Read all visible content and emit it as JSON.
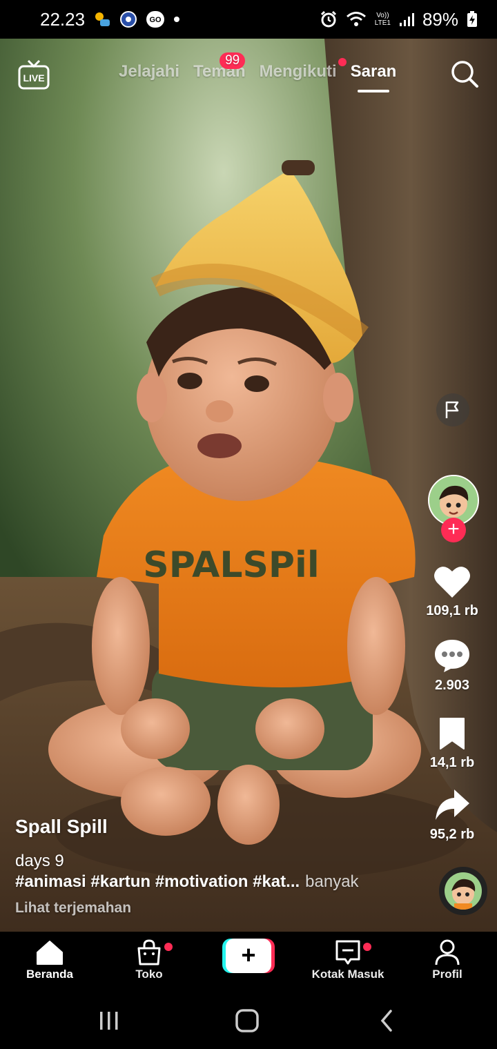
{
  "status_bar": {
    "time": "22.23",
    "network_top": "Vo))",
    "network_bottom": "LTE1",
    "battery": "89%"
  },
  "top_nav": {
    "live_label": "LIVE",
    "tabs": [
      {
        "label": "Jelajahi"
      },
      {
        "label": "Teman",
        "badge": "99"
      },
      {
        "label": "Mengikuti"
      },
      {
        "label": "Saran"
      }
    ]
  },
  "video": {
    "shirt_text": "SPALSPil"
  },
  "actions": {
    "likes": "109,1 rb",
    "comments": "2.903",
    "saves": "14,1 rb",
    "shares": "95,2 rb",
    "follow_symbol": "+"
  },
  "caption": {
    "author": "Spall Spill",
    "description": "days 9",
    "hashtags": "#animasi #kartun #motivation #kat...",
    "more": "banyak",
    "translate": "Lihat terjemahan"
  },
  "bottom_nav": {
    "home": "Beranda",
    "shop": "Toko",
    "create": "+",
    "inbox": "Kotak Masuk",
    "profile": "Profil"
  },
  "colors": {
    "accent": "#fe2c55",
    "cyan": "#25f4ee"
  }
}
